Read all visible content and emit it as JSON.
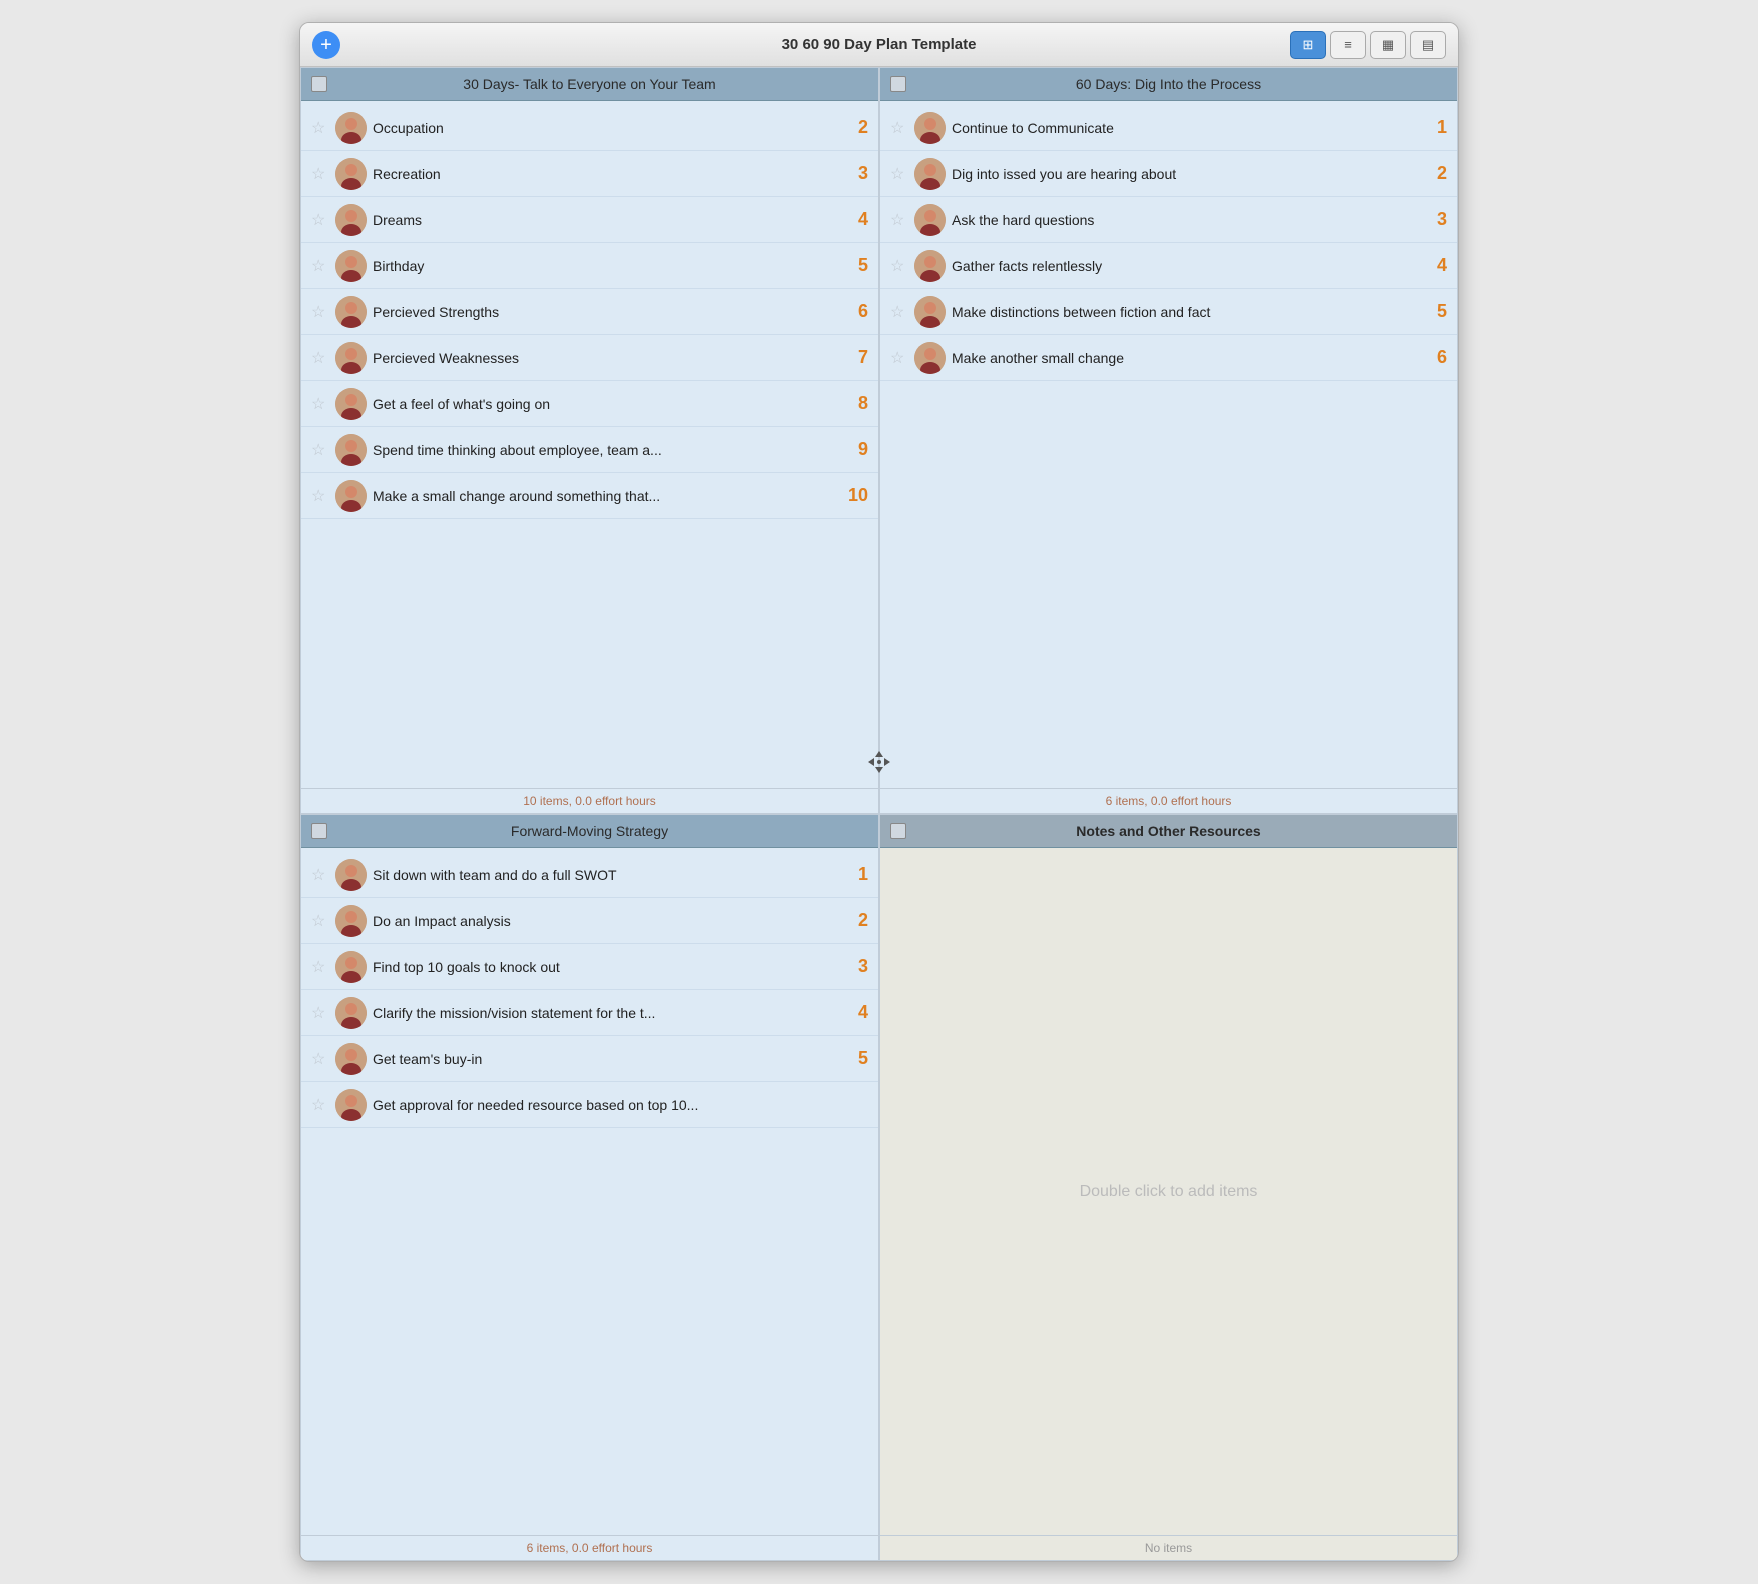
{
  "window": {
    "title": "30 60 90 Day Plan Template"
  },
  "toolbar": {
    "add_label": "+",
    "views": [
      {
        "label": "⊞",
        "active": true
      },
      {
        "label": "≡",
        "active": false
      },
      {
        "label": "▦",
        "active": false
      },
      {
        "label": "▤",
        "active": false
      }
    ]
  },
  "quadrants": [
    {
      "id": "q1",
      "header": "30 Days- Talk to Everyone on Your Team",
      "bold": false,
      "footer": "10 items, 0.0 effort hours",
      "items": [
        {
          "label": "Occupation",
          "number": "2"
        },
        {
          "label": "Recreation",
          "number": "3"
        },
        {
          "label": "Dreams",
          "number": "4"
        },
        {
          "label": "Birthday",
          "number": "5"
        },
        {
          "label": "Percieved Strengths",
          "number": "6"
        },
        {
          "label": "Percieved Weaknesses",
          "number": "7"
        },
        {
          "label": "Get a feel of what's going on",
          "number": "8"
        },
        {
          "label": "Spend time thinking about employee, team a...",
          "number": "9"
        },
        {
          "label": "Make a small change around something that...",
          "number": "10"
        }
      ]
    },
    {
      "id": "q2",
      "header": "60 Days: Dig Into the Process",
      "bold": false,
      "footer": "6 items, 0.0 effort hours",
      "items": [
        {
          "label": "Continue to Communicate",
          "number": "1"
        },
        {
          "label": "Dig into issed you are hearing about",
          "number": "2"
        },
        {
          "label": "Ask the hard questions",
          "number": "3"
        },
        {
          "label": "Gather facts relentlessly",
          "number": "4"
        },
        {
          "label": "Make distinctions between fiction and fact",
          "number": "5"
        },
        {
          "label": "Make another small change",
          "number": "6"
        }
      ]
    },
    {
      "id": "q3",
      "header": "Forward-Moving Strategy",
      "bold": false,
      "footer": "6 items, 0.0 effort hours",
      "items": [
        {
          "label": "Sit down with team and do a full SWOT",
          "number": "1"
        },
        {
          "label": "Do an Impact analysis",
          "number": "2"
        },
        {
          "label": "Find top 10 goals to knock out",
          "number": "3"
        },
        {
          "label": "Clarify the mission/vision statement for the t...",
          "number": "4"
        },
        {
          "label": "Get team's buy-in",
          "number": "5"
        },
        {
          "label": "Get approval for needed resource based on top 10...",
          "number": ""
        }
      ]
    },
    {
      "id": "q4",
      "header": "Notes and Other Resources",
      "bold": true,
      "footer": "No items",
      "notes_placeholder": "Double click to add items"
    }
  ]
}
